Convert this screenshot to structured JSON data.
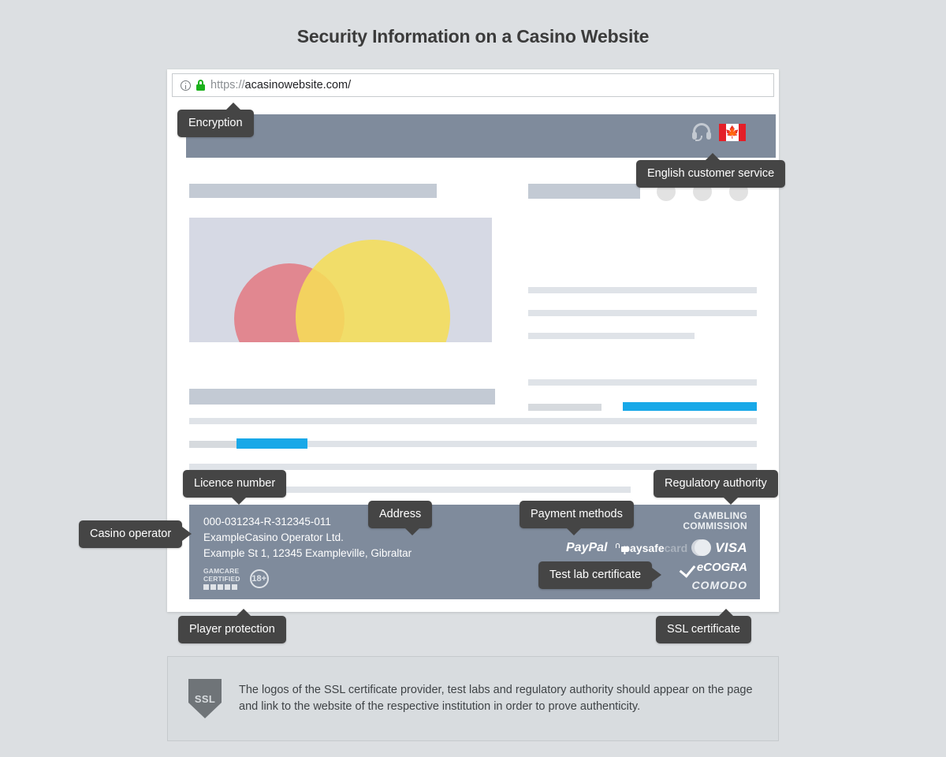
{
  "page": {
    "title": "Security Information on a Casino Website",
    "background_color": "#dcdfe2"
  },
  "browser": {
    "urlbar": {
      "info_icon": "info-icon",
      "lock_icon": "lock-icon",
      "lock_color": "#1bb11b",
      "scheme": "https://",
      "host": "acasinowebsite.com/"
    }
  },
  "site": {
    "header": {
      "background_color": "#7f8b9c",
      "support_icon": "headset-icon",
      "flag_icon": "canada-flag-icon",
      "flag_leaf": "🍁"
    },
    "hero": {
      "circle_red": "#e27b84",
      "circle_yellow": "#f5dd58",
      "placeholder_color": "#d6d9e4"
    },
    "accent_color": "#18a8e8"
  },
  "footer": {
    "background_color": "#7f8b9c",
    "licence_number": "000-031234-R-312345-011",
    "operator_name": "ExampleCasino Operator Ltd.",
    "address": "Example St 1, 12345 Exampleville, Gibraltar",
    "gamcare_line1": "GAMCARE",
    "gamcare_line2": "CERTIFIED",
    "age_badge": "18+",
    "regulator_line1": "GAMBLING",
    "regulator_line2": "COMMISSION",
    "paypal": "PayPal",
    "paysafe_white": "paysafe",
    "paysafe_grey": "card",
    "visa": "VISA",
    "ecogra": "eCOGRA",
    "comodo": "COMODO"
  },
  "callouts": {
    "encryption": "Encryption",
    "customer_service": "English customer service",
    "licence_number": "Licence number",
    "regulatory_authority": "Regulatory authority",
    "casino_operator": "Casino operator",
    "address": "Address",
    "payment_methods": "Payment methods",
    "test_lab": "Test lab certificate",
    "player_protection": "Player protection",
    "ssl_certificate": "SSL certificate"
  },
  "note": {
    "shield_label": "SSL",
    "text": "The logos of the SSL certificate provider, test labs and regulatory authority should appear on the page and link to the website of the respective institution in order to prove authenticity."
  }
}
